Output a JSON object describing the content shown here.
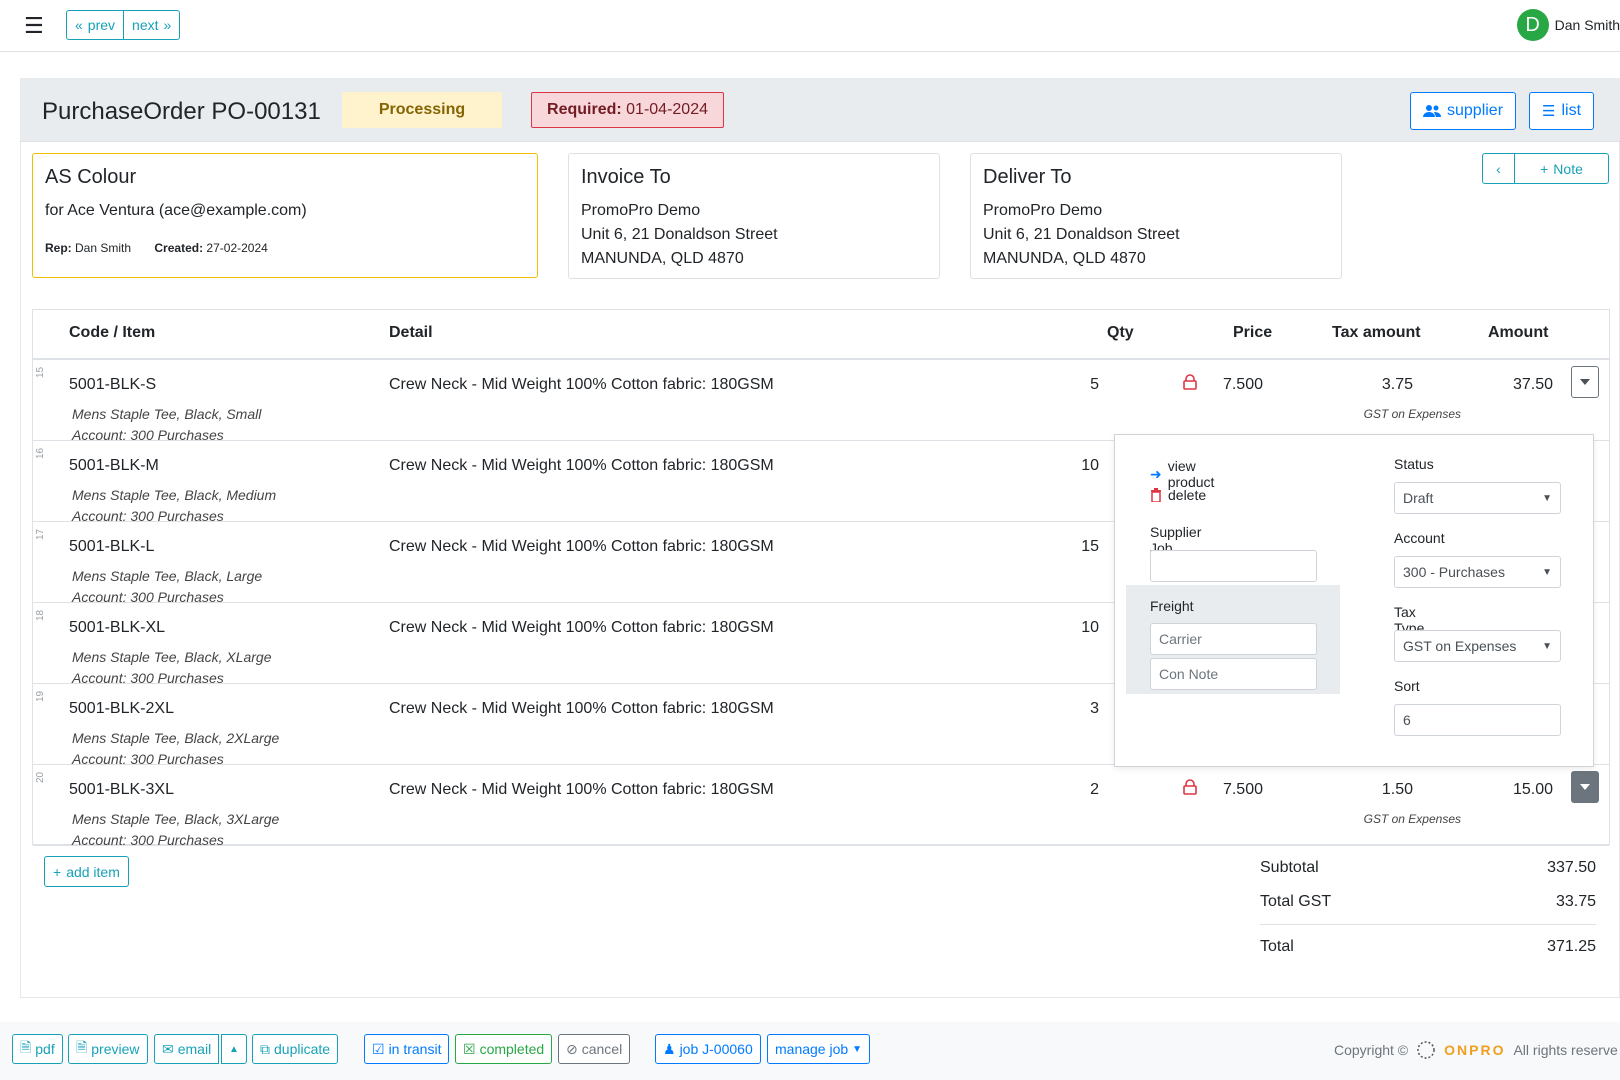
{
  "topbar": {
    "prev": "prev",
    "next": "next",
    "user_initial": "D",
    "user_name": "Dan Smith"
  },
  "header": {
    "title": "PurchaseOrder PO-00131",
    "status": "Processing",
    "required_label": "Required:",
    "required_date": "01-04-2024",
    "supplier_btn": "supplier",
    "list_btn": "list"
  },
  "supplier_card": {
    "name": "AS Colour",
    "for": "for Ace Ventura (ace@example.com)",
    "rep_label": "Rep:",
    "rep": "Dan Smith",
    "created_label": "Created:",
    "created": "27-02-2024"
  },
  "invoice_to": {
    "title": "Invoice To",
    "line1": "PromoPro Demo",
    "line2": "Unit 6, 21 Donaldson Street",
    "line3": "MANUNDA, QLD 4870"
  },
  "deliver_to": {
    "title": "Deliver To",
    "line1": "PromoPro Demo",
    "line2": "Unit 6, 21 Donaldson Street",
    "line3": "MANUNDA, QLD 4870"
  },
  "note_btn": "Note",
  "table": {
    "headers": {
      "code": "Code / Item",
      "detail": "Detail",
      "qty": "Qty",
      "price": "Price",
      "tax": "Tax amount",
      "amount": "Amount"
    },
    "rows": [
      {
        "num": "15",
        "code": "5001-BLK-S",
        "desc1": "Mens Staple Tee, Black, Small",
        "desc2": "Account: 300 Purchases",
        "detail": "Crew Neck - Mid Weight 100% Cotton fabric: 180GSM",
        "qty": "5",
        "price": "7.500",
        "tax": "3.75",
        "taxnote": "GST on Expenses",
        "amount": "37.50"
      },
      {
        "num": "16",
        "code": "5001-BLK-M",
        "desc1": "Mens Staple Tee, Black, Medium",
        "desc2": "Account: 300 Purchases",
        "detail": "Crew Neck - Mid Weight 100% Cotton fabric: 180GSM",
        "qty": "10",
        "price": "",
        "tax": "",
        "taxnote": "",
        "amount": ""
      },
      {
        "num": "17",
        "code": "5001-BLK-L",
        "desc1": "Mens Staple Tee, Black, Large",
        "desc2": "Account: 300 Purchases",
        "detail": "Crew Neck - Mid Weight 100% Cotton fabric: 180GSM",
        "qty": "15",
        "price": "",
        "tax": "",
        "taxnote": "",
        "amount": ""
      },
      {
        "num": "18",
        "code": "5001-BLK-XL",
        "desc1": "Mens Staple Tee, Black, XLarge",
        "desc2": "Account: 300 Purchases",
        "detail": "Crew Neck - Mid Weight 100% Cotton fabric: 180GSM",
        "qty": "10",
        "price": "",
        "tax": "",
        "taxnote": "",
        "amount": ""
      },
      {
        "num": "19",
        "code": "5001-BLK-2XL",
        "desc1": "Mens Staple Tee, Black, 2XLarge",
        "desc2": "Account: 300 Purchases",
        "detail": "Crew Neck - Mid Weight 100% Cotton fabric: 180GSM",
        "qty": "3",
        "price": "",
        "tax": "",
        "taxnote": "",
        "amount": ""
      },
      {
        "num": "20",
        "code": "5001-BLK-3XL",
        "desc1": "Mens Staple Tee, Black, 3XLarge",
        "desc2": "Account: 300 Purchases",
        "detail": "Crew Neck - Mid Weight 100% Cotton fabric: 180GSM",
        "qty": "2",
        "price": "7.500",
        "tax": "1.50",
        "taxnote": "GST on Expenses",
        "amount": "15.00"
      }
    ]
  },
  "popover": {
    "view_product": "view product",
    "delete": "delete",
    "supplier_job_label": "Supplier Job",
    "supplier_job_value": "",
    "freight_label": "Freight",
    "carrier_placeholder": "Carrier",
    "con_note_placeholder": "Con Note",
    "status_label": "Status",
    "status_value": "Draft",
    "account_label": "Account",
    "account_value": "300 - Purchases",
    "tax_type_label": "Tax Type",
    "tax_type_value": "GST on Expenses",
    "sort_label": "Sort",
    "sort_value": "6"
  },
  "add_item": "add item",
  "totals": {
    "subtotal_label": "Subtotal",
    "subtotal": "337.50",
    "gst_label": "Total GST",
    "gst": "33.75",
    "total_label": "Total",
    "total": "371.25"
  },
  "footer": {
    "pdf": "pdf",
    "preview": "preview",
    "email": "email",
    "duplicate": "duplicate",
    "in_transit": "in transit",
    "completed": "completed",
    "cancel": "cancel",
    "job": "job J-00060",
    "manage_job": "manage job",
    "copyright": "Copyright ©",
    "brand": "ONPRO",
    "rights": "All rights reserve"
  },
  "colors": {
    "info": "#17a2b8",
    "primary": "#007bff",
    "success": "#28a745",
    "danger": "#dc3545",
    "warning_bg": "#fff3cd"
  }
}
